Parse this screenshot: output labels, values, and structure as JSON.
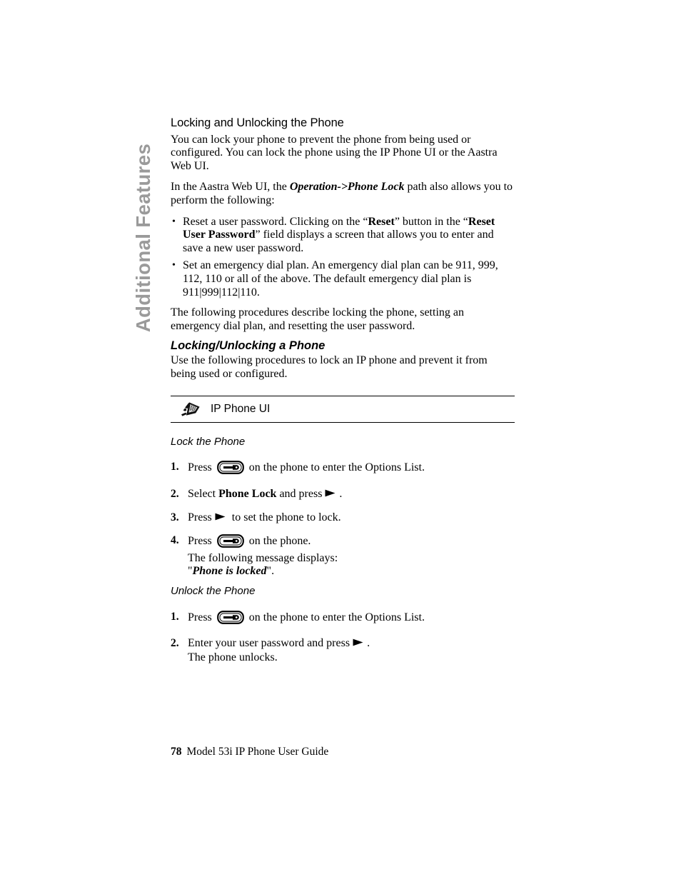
{
  "chapter_tab": {
    "label": "Additional Features",
    "color": "#9a9a9a"
  },
  "section": {
    "title": "Locking and Unlocking the Phone",
    "intro_paragraph": "You can lock your phone to prevent the phone from being used or configured. You can lock the phone using the IP Phone UI or the Aastra Web UI.",
    "path_para": {
      "before": "In the Aastra Web UI, the ",
      "bold_italic": "Operation->Phone Lock",
      "after": " path also allows you to perform the following:"
    },
    "bullets": [
      {
        "bullet_glyph": "•",
        "part1": "Reset a user password. Clicking on the “",
        "bold1": "Reset",
        "part2": "” button in the “",
        "bold2": "Reset User Password",
        "part3": "” field displays a screen that allows you to enter and save a new user password."
      },
      {
        "bullet_glyph": "•",
        "part1": "Set an emergency dial plan. An emergency dial plan can be 911, 999, 112, 110 or all of the above. The default emergency dial plan is 911|999|112|110.",
        "bold1": "",
        "part2": "",
        "bold2": "",
        "part3": ""
      }
    ],
    "closing_paragraph": "The following procedures describe locking the phone, setting an emergency dial plan, and resetting the user password.",
    "sub_heading": "Locking/Unlocking a Phone",
    "sub_paragraph": "Use the following procedures to lock an IP phone and prevent it from being used or configured."
  },
  "banner": {
    "icon_name": "ip-phone-icon",
    "label": "IP Phone UI"
  },
  "lock_procedure": {
    "heading": "Lock the Phone",
    "steps": [
      {
        "number": "1.",
        "text_before": "Press",
        "icon": "options-key-icon",
        "text_after": "on the phone to enter the Options List.",
        "sub_lines": []
      },
      {
        "number": "2.",
        "text_before": "Select",
        "bold_mid": "Phone Lock",
        "text_mid": "and press",
        "icon": "right-arrow-key-icon",
        "text_after": ".",
        "sub_lines": []
      },
      {
        "number": "3.",
        "text_before": "Press",
        "icon": "right-arrow-key-icon",
        "text_after": "to set the phone to lock.",
        "sub_lines": []
      },
      {
        "number": "4.",
        "text_before": "Press",
        "icon": "options-key-icon",
        "text_after": "on the phone.",
        "sub_lines": [
          "The following message displays:",
          "\"Phone is locked\"."
        ],
        "sub_line_2_quote_open": "\"",
        "sub_line_2_bold_italic": "Phone is locked",
        "sub_line_2_quote_close": "\"."
      }
    ]
  },
  "unlock_procedure": {
    "heading": "Unlock the Phone",
    "steps": [
      {
        "number": "1.",
        "text_before": "Press",
        "icon": "options-key-icon",
        "text_after": "on the phone to enter the Options List.",
        "sub_lines": []
      },
      {
        "number": "2.",
        "text_before": "Enter your user password and press",
        "icon": "right-arrow-key-icon",
        "text_after": ".",
        "sub_lines": [
          "The phone unlocks."
        ]
      }
    ]
  },
  "footer": {
    "page_number": "78",
    "document_title": "Model 53i IP Phone User Guide"
  }
}
